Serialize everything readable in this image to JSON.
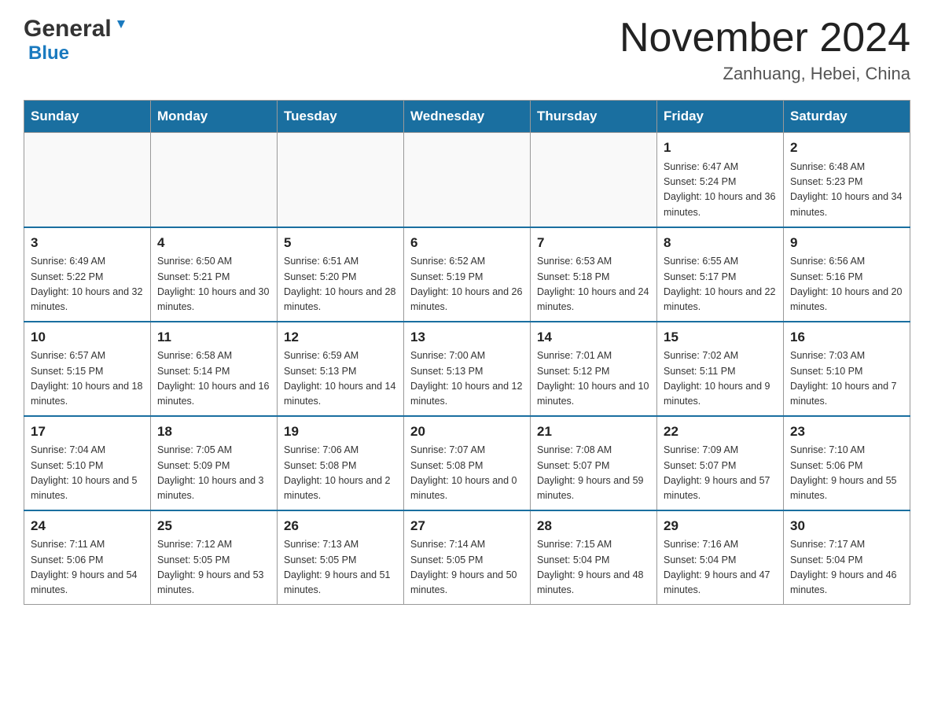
{
  "header": {
    "logo_general": "General",
    "logo_blue": "Blue",
    "month_title": "November 2024",
    "location": "Zanhuang, Hebei, China"
  },
  "days_of_week": [
    "Sunday",
    "Monday",
    "Tuesday",
    "Wednesday",
    "Thursday",
    "Friday",
    "Saturday"
  ],
  "weeks": [
    {
      "days": [
        {
          "number": "",
          "info": ""
        },
        {
          "number": "",
          "info": ""
        },
        {
          "number": "",
          "info": ""
        },
        {
          "number": "",
          "info": ""
        },
        {
          "number": "",
          "info": ""
        },
        {
          "number": "1",
          "info": "Sunrise: 6:47 AM\nSunset: 5:24 PM\nDaylight: 10 hours and 36 minutes."
        },
        {
          "number": "2",
          "info": "Sunrise: 6:48 AM\nSunset: 5:23 PM\nDaylight: 10 hours and 34 minutes."
        }
      ]
    },
    {
      "days": [
        {
          "number": "3",
          "info": "Sunrise: 6:49 AM\nSunset: 5:22 PM\nDaylight: 10 hours and 32 minutes."
        },
        {
          "number": "4",
          "info": "Sunrise: 6:50 AM\nSunset: 5:21 PM\nDaylight: 10 hours and 30 minutes."
        },
        {
          "number": "5",
          "info": "Sunrise: 6:51 AM\nSunset: 5:20 PM\nDaylight: 10 hours and 28 minutes."
        },
        {
          "number": "6",
          "info": "Sunrise: 6:52 AM\nSunset: 5:19 PM\nDaylight: 10 hours and 26 minutes."
        },
        {
          "number": "7",
          "info": "Sunrise: 6:53 AM\nSunset: 5:18 PM\nDaylight: 10 hours and 24 minutes."
        },
        {
          "number": "8",
          "info": "Sunrise: 6:55 AM\nSunset: 5:17 PM\nDaylight: 10 hours and 22 minutes."
        },
        {
          "number": "9",
          "info": "Sunrise: 6:56 AM\nSunset: 5:16 PM\nDaylight: 10 hours and 20 minutes."
        }
      ]
    },
    {
      "days": [
        {
          "number": "10",
          "info": "Sunrise: 6:57 AM\nSunset: 5:15 PM\nDaylight: 10 hours and 18 minutes."
        },
        {
          "number": "11",
          "info": "Sunrise: 6:58 AM\nSunset: 5:14 PM\nDaylight: 10 hours and 16 minutes."
        },
        {
          "number": "12",
          "info": "Sunrise: 6:59 AM\nSunset: 5:13 PM\nDaylight: 10 hours and 14 minutes."
        },
        {
          "number": "13",
          "info": "Sunrise: 7:00 AM\nSunset: 5:13 PM\nDaylight: 10 hours and 12 minutes."
        },
        {
          "number": "14",
          "info": "Sunrise: 7:01 AM\nSunset: 5:12 PM\nDaylight: 10 hours and 10 minutes."
        },
        {
          "number": "15",
          "info": "Sunrise: 7:02 AM\nSunset: 5:11 PM\nDaylight: 10 hours and 9 minutes."
        },
        {
          "number": "16",
          "info": "Sunrise: 7:03 AM\nSunset: 5:10 PM\nDaylight: 10 hours and 7 minutes."
        }
      ]
    },
    {
      "days": [
        {
          "number": "17",
          "info": "Sunrise: 7:04 AM\nSunset: 5:10 PM\nDaylight: 10 hours and 5 minutes."
        },
        {
          "number": "18",
          "info": "Sunrise: 7:05 AM\nSunset: 5:09 PM\nDaylight: 10 hours and 3 minutes."
        },
        {
          "number": "19",
          "info": "Sunrise: 7:06 AM\nSunset: 5:08 PM\nDaylight: 10 hours and 2 minutes."
        },
        {
          "number": "20",
          "info": "Sunrise: 7:07 AM\nSunset: 5:08 PM\nDaylight: 10 hours and 0 minutes."
        },
        {
          "number": "21",
          "info": "Sunrise: 7:08 AM\nSunset: 5:07 PM\nDaylight: 9 hours and 59 minutes."
        },
        {
          "number": "22",
          "info": "Sunrise: 7:09 AM\nSunset: 5:07 PM\nDaylight: 9 hours and 57 minutes."
        },
        {
          "number": "23",
          "info": "Sunrise: 7:10 AM\nSunset: 5:06 PM\nDaylight: 9 hours and 55 minutes."
        }
      ]
    },
    {
      "days": [
        {
          "number": "24",
          "info": "Sunrise: 7:11 AM\nSunset: 5:06 PM\nDaylight: 9 hours and 54 minutes."
        },
        {
          "number": "25",
          "info": "Sunrise: 7:12 AM\nSunset: 5:05 PM\nDaylight: 9 hours and 53 minutes."
        },
        {
          "number": "26",
          "info": "Sunrise: 7:13 AM\nSunset: 5:05 PM\nDaylight: 9 hours and 51 minutes."
        },
        {
          "number": "27",
          "info": "Sunrise: 7:14 AM\nSunset: 5:05 PM\nDaylight: 9 hours and 50 minutes."
        },
        {
          "number": "28",
          "info": "Sunrise: 7:15 AM\nSunset: 5:04 PM\nDaylight: 9 hours and 48 minutes."
        },
        {
          "number": "29",
          "info": "Sunrise: 7:16 AM\nSunset: 5:04 PM\nDaylight: 9 hours and 47 minutes."
        },
        {
          "number": "30",
          "info": "Sunrise: 7:17 AM\nSunset: 5:04 PM\nDaylight: 9 hours and 46 minutes."
        }
      ]
    }
  ]
}
